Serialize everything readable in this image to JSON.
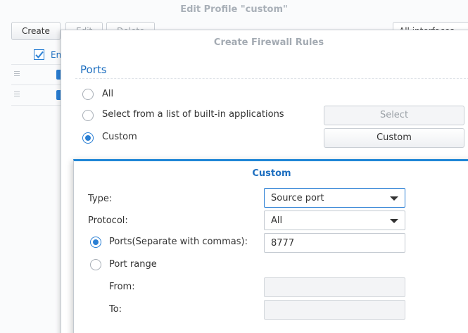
{
  "back_window": {
    "title": "Edit Profile \"custom\"",
    "toolbar": {
      "create": "Create",
      "edit": "Edit",
      "delete": "Delete"
    },
    "interfaces": "All interfaces",
    "grid_header": "En"
  },
  "firewall_window": {
    "title": "Create Firewall Rules",
    "section": "Ports",
    "options": {
      "all": "All",
      "builtin": "Select from a list of built-in applications",
      "custom": "Custom"
    },
    "selected_option": "custom",
    "buttons": {
      "select": "Select",
      "custom": "Custom"
    }
  },
  "custom_dialog": {
    "title": "Custom",
    "type_label": "Type:",
    "type_value": "Source port",
    "protocol_label": "Protocol:",
    "protocol_value": "All",
    "ports_label": "Ports(Separate with commas):",
    "ports_value": "8777",
    "port_range_label": "Port range",
    "from_label": "From:",
    "to_label": "To:",
    "from_value": "",
    "to_value": "",
    "selected_mode": "ports"
  },
  "colors": {
    "accent": "#2a7fd4",
    "heading": "#1e6fc0",
    "dialog_top_border": "#1f86d6"
  }
}
